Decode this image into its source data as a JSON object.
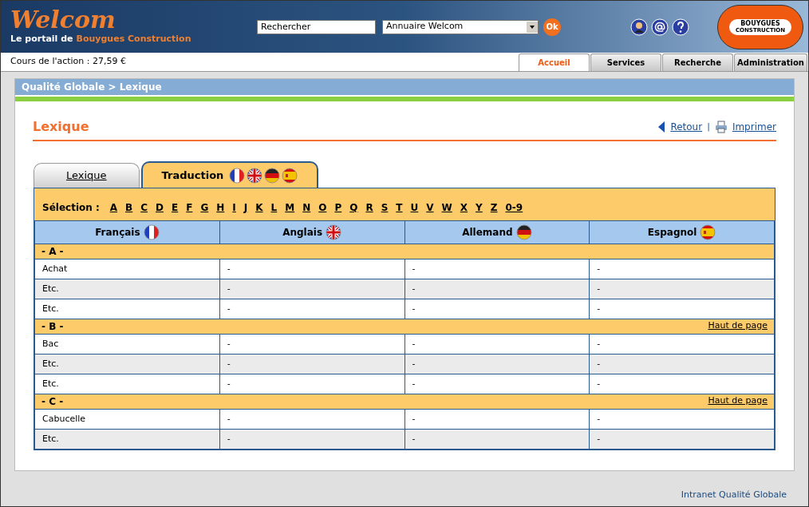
{
  "header": {
    "logo": "Welcom",
    "tagline_prefix": "Le portail de",
    "tagline_brand": "Bouygues Construction",
    "search": {
      "placeholder": "Rechercher"
    },
    "directory_select": "Annuaire Welcom",
    "ok_button": "Ok",
    "brand_logo": [
      "BOUYGUES",
      "CONSTRUCTION"
    ]
  },
  "stock": "Cours de l'action : 27,59  €",
  "nav_tabs": [
    {
      "label": "Accueil",
      "selected": true
    },
    {
      "label": "Services",
      "selected": false
    },
    {
      "label": "Recherche",
      "selected": false
    },
    {
      "label": "Administration",
      "selected": false
    }
  ],
  "breadcrumb": "Qualité Globale > Lexique",
  "page_title": "Lexique",
  "actions": [
    {
      "label": "Retour"
    },
    {
      "label": "Imprimer"
    }
  ],
  "action_separator": "|",
  "content_tabs": [
    {
      "label": "Lexique",
      "selected": false,
      "flags": false
    },
    {
      "label": "Traduction",
      "selected": true,
      "flags": true
    }
  ],
  "selection_label": "Sélection :",
  "letters": [
    "A",
    "B",
    "C",
    "D",
    "E",
    "F",
    "G",
    "H",
    "I",
    "J",
    "K",
    "L",
    "M",
    "N",
    "O",
    "P",
    "Q",
    "R",
    "S",
    "T",
    "U",
    "V",
    "W",
    "X",
    "Y",
    "Z",
    "0-9"
  ],
  "columns": [
    "Français",
    "Anglais",
    "Allemand",
    "Espagnol"
  ],
  "groups": [
    {
      "heading": "- A -",
      "rows": [
        [
          "Achat",
          "-",
          "-",
          "-"
        ],
        [
          "Etc.",
          "-",
          "-",
          "-"
        ],
        [
          "Etc.",
          "-",
          "-",
          "-"
        ]
      ]
    },
    {
      "heading": "- B -",
      "top_link": "Haut de page",
      "rows": [
        [
          "Bac",
          "-",
          "-",
          "-"
        ],
        [
          "Etc.",
          "-",
          "-",
          "-"
        ],
        [
          "Etc.",
          "-",
          "-",
          "-"
        ]
      ]
    },
    {
      "heading": "- C -",
      "top_link": "Haut de page",
      "rows": [
        [
          "Cabucelle",
          "-",
          "-",
          "-"
        ],
        [
          "Etc.",
          "-",
          "-",
          "-"
        ]
      ]
    }
  ],
  "footer": "Intranet Qualité Globale"
}
